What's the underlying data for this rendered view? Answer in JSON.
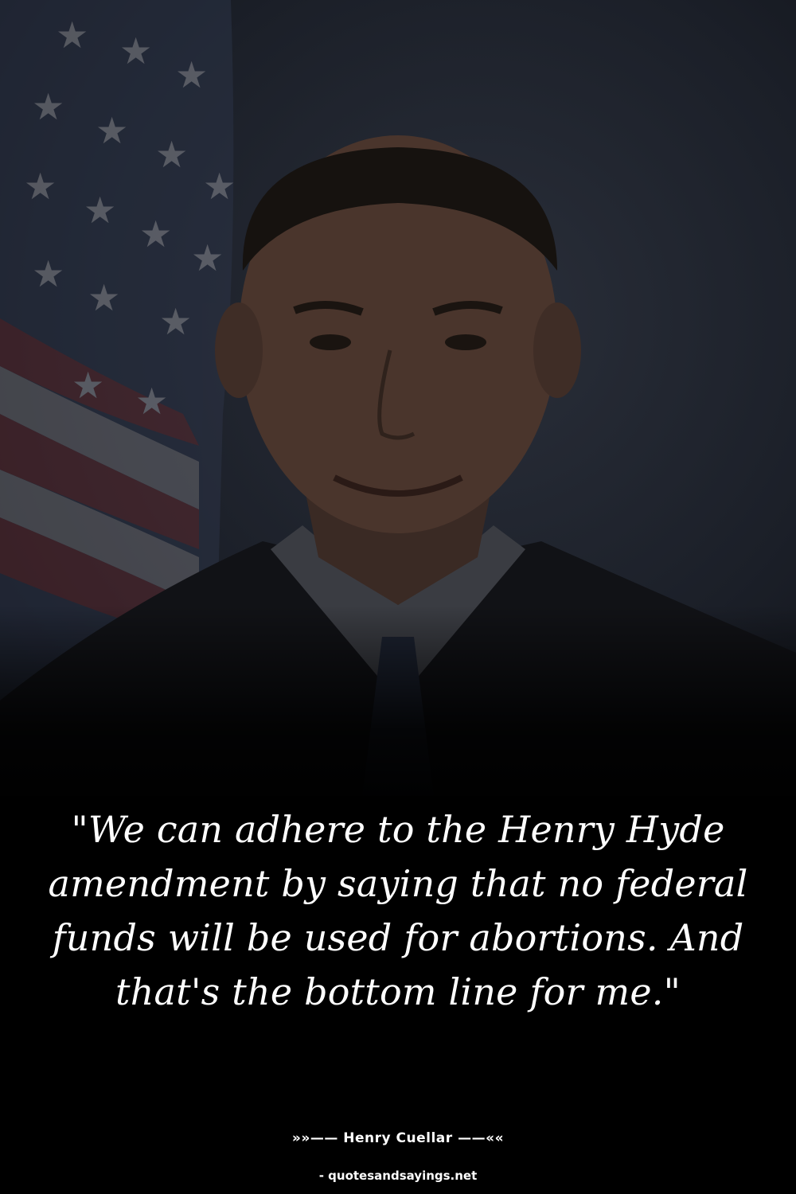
{
  "photo": {
    "subject": "portrait-photo",
    "flag": "american-flag"
  },
  "quote": {
    "text": "\"We can adhere to the Henry Hyde amendment by saying that no federal funds will be used for abortions. And that's the bottom line for me.\""
  },
  "author": {
    "text": "»»—— Henry Cuellar ——««"
  },
  "source": {
    "text": "- quotesandsayings.net"
  },
  "colors": {
    "background": "#000000",
    "text": "#ffffff"
  }
}
